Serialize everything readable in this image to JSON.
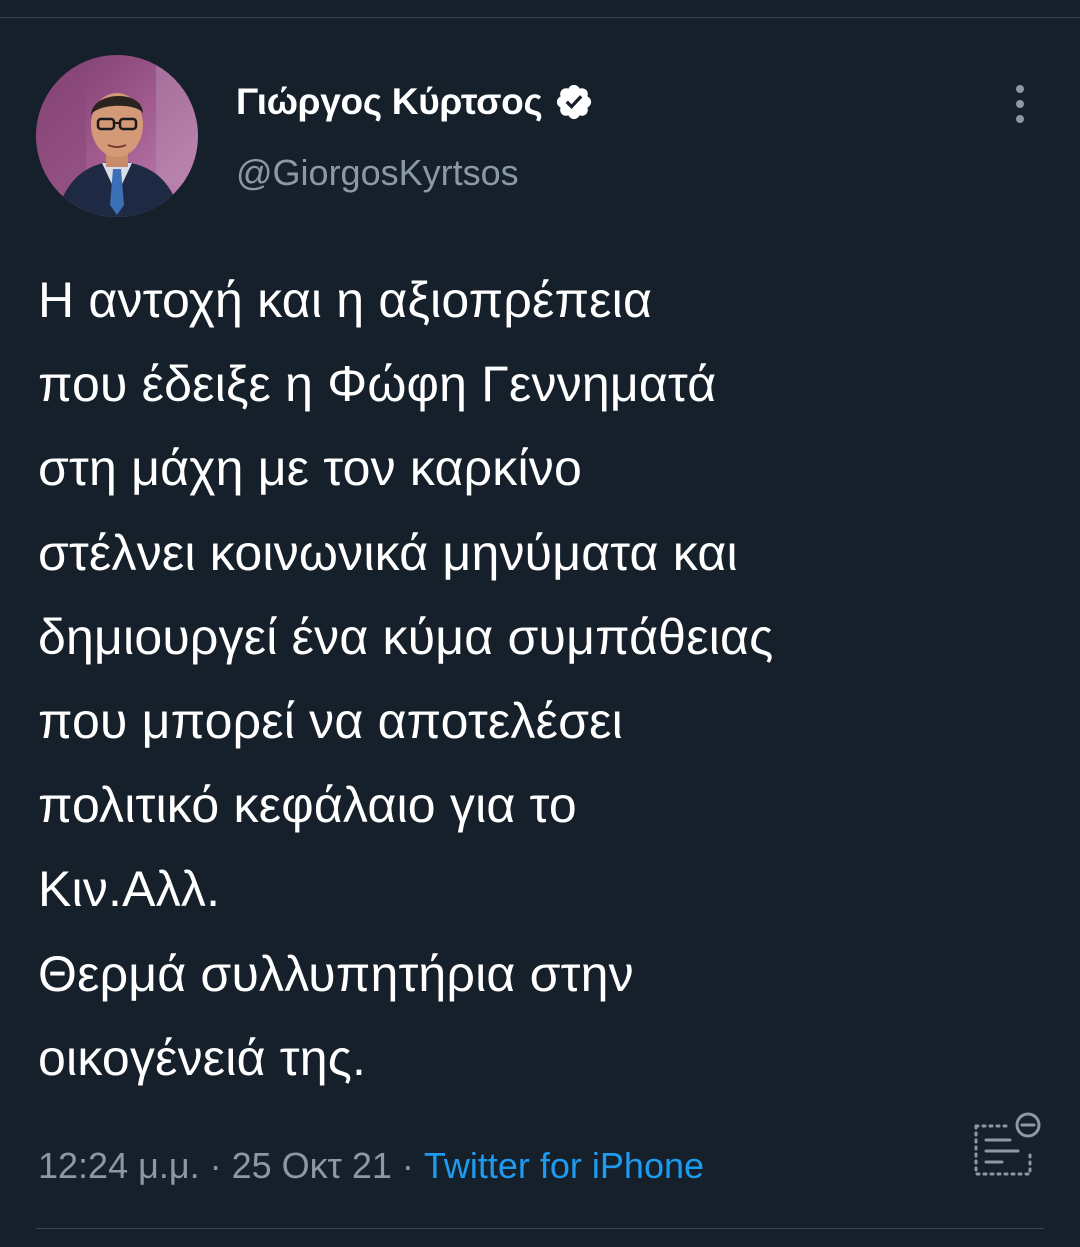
{
  "tweet": {
    "author": {
      "display_name": "Γιώργος Κύρτσος",
      "handle": "@GiorgosKyrtsos",
      "verified": true
    },
    "text_lines": [
      "Η αντοχή και η αξιοπρέπεια",
      "που έδειξε η Φώφη Γεννηματά",
      "στη μάχη με τον καρκίνο",
      "στέλνει κοινωνικά μηνύματα και",
      "δημιουργεί ένα κύμα συμπάθειας",
      "που μπορεί να αποτελέσει",
      "πολιτικό κεφάλαιο για το",
      "Κιν.Αλλ.",
      "Θερμά συλλυπητήρια στην",
      "οικογένειά της."
    ],
    "meta": {
      "time": "12:24 μ.μ.",
      "separator": " · ",
      "date": "25 Οκτ 21",
      "source": "Twitter for iPhone"
    }
  },
  "icons": {
    "verified": "verified-badge-icon",
    "more": "vertical-ellipsis-icon",
    "analytics": "tweet-analytics-icon"
  },
  "colors": {
    "background": "#15202b",
    "text_primary": "#ffffff",
    "text_secondary": "#8b98a5",
    "link": "#1d9bf0",
    "divider": "#38444d"
  }
}
